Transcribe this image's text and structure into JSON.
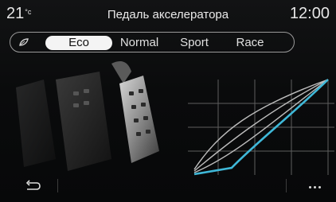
{
  "header": {
    "temperature": "21",
    "temperature_unit": "°c",
    "title": "Педаль акселератора",
    "time": "12:00"
  },
  "modes": {
    "icon": "leaf-icon",
    "items": [
      {
        "label": "Eco",
        "active": true
      },
      {
        "label": "Normal",
        "active": false
      },
      {
        "label": "Sport",
        "active": false
      },
      {
        "label": "Race",
        "active": false
      }
    ]
  },
  "colors": {
    "active_curve": "#3fb8d8",
    "inactive_curve": "#bdbdbd",
    "grid": "#6a6a6a"
  },
  "footer": {
    "back_icon": "back-arrow-icon",
    "more_icon": "more-dots-icon"
  }
}
